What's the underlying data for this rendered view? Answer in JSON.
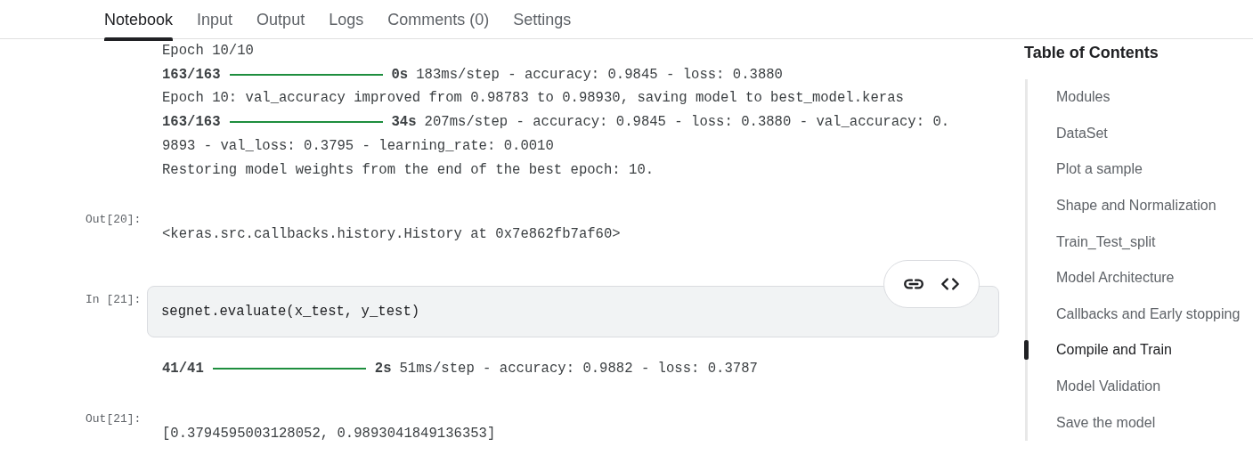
{
  "tabs": [
    {
      "label": "Notebook",
      "selected": true
    },
    {
      "label": "Input",
      "selected": false
    },
    {
      "label": "Output",
      "selected": false
    },
    {
      "label": "Logs",
      "selected": false
    },
    {
      "label": "Comments (0)",
      "selected": false
    },
    {
      "label": "Settings",
      "selected": false
    }
  ],
  "cells": [
    {
      "kind": "output",
      "lines": [
        {
          "kind": "text",
          "text": "Epoch 10/10"
        },
        {
          "kind": "progress",
          "count": "163/163",
          "level": 1,
          "time": "0s",
          "rest": "183ms/step - accuracy: 0.9845 - loss: 0.3880"
        },
        {
          "kind": "text",
          "text": "Epoch 10: val_accuracy improved from 0.98783 to 0.98930, saving model to best_model.keras"
        },
        {
          "kind": "progress",
          "count": "163/163",
          "level": 1,
          "time": "34s",
          "rest": "207ms/step - accuracy: 0.9845 - loss: 0.3880 - val_accuracy: 0."
        },
        {
          "kind": "text",
          "text": "9893 - val_loss: 0.3795 - learning_rate: 0.0010"
        },
        {
          "kind": "text",
          "text": "Restoring model weights from the end of the best epoch: 10."
        }
      ]
    },
    {
      "kind": "output",
      "prompt": "Out[20]:",
      "lines": [
        {
          "kind": "text",
          "text": "<keras.src.callbacks.history.History at 0x7e862fb7af60>"
        }
      ]
    },
    {
      "kind": "input",
      "prompt": "In [21]:",
      "code": "segnet.evaluate(x_test, y_test)"
    },
    {
      "kind": "output",
      "lines": [
        {
          "kind": "progress",
          "count": "41/41",
          "level": 1,
          "time": "2s",
          "rest": "51ms/step - accuracy: 0.9882 - loss: 0.3787"
        }
      ]
    },
    {
      "kind": "output",
      "prompt": "Out[21]:",
      "lines": [
        {
          "kind": "text",
          "text": "[0.3794595003128052, 0.9893041849136353]"
        }
      ]
    }
  ],
  "toc": {
    "title": "Table of Contents",
    "items": [
      {
        "label": "Modules",
        "selected": false
      },
      {
        "label": "DataSet",
        "selected": false
      },
      {
        "label": "Plot a sample",
        "selected": false
      },
      {
        "label": "Shape and Normalization",
        "selected": false
      },
      {
        "label": "Train_Test_split",
        "selected": false
      },
      {
        "label": "Model Architecture",
        "selected": false
      },
      {
        "label": "Callbacks and Early stopping",
        "selected": false
      },
      {
        "label": "Compile and Train",
        "selected": true
      },
      {
        "label": "Model Validation",
        "selected": false
      },
      {
        "label": "Save the model",
        "selected": false
      }
    ]
  }
}
